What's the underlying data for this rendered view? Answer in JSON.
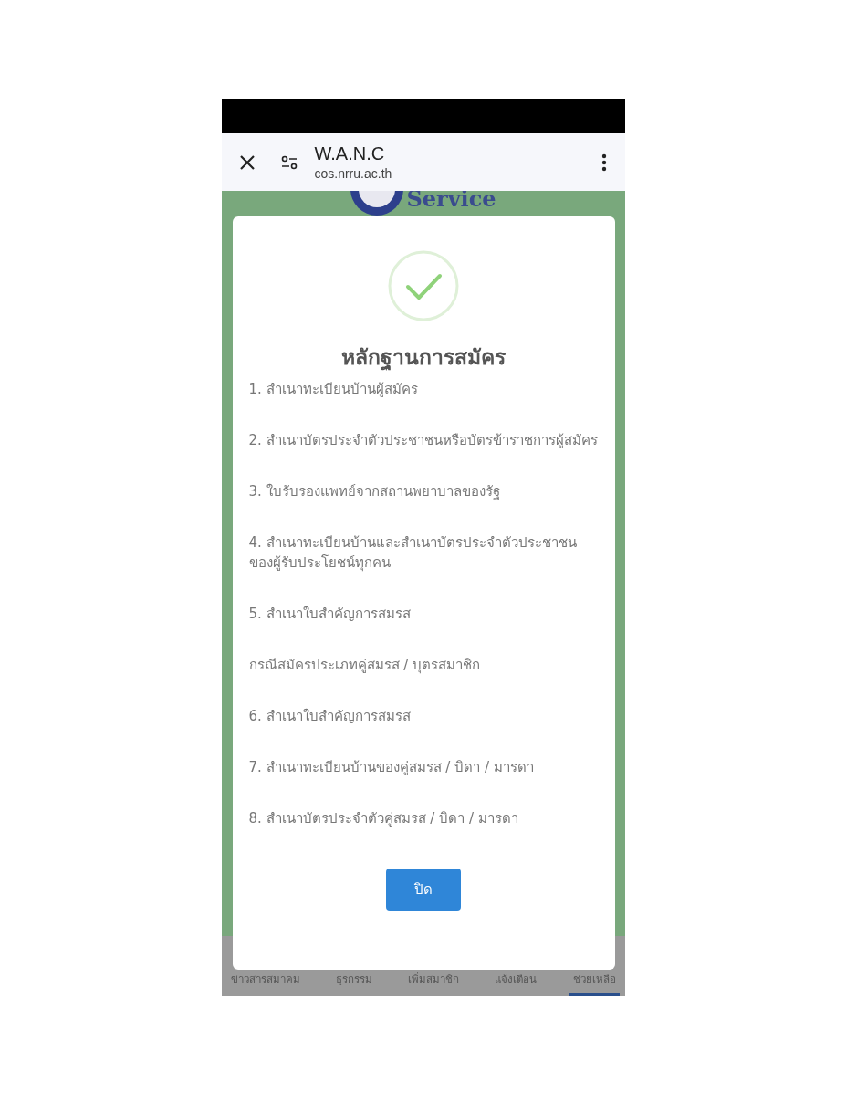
{
  "browser_bar": {
    "title": "W.A.N.C",
    "url": "cos.nrru.ac.th"
  },
  "background": {
    "logo_text": "Service"
  },
  "dialog": {
    "title": "หลักฐานการสมัคร",
    "items": [
      "1. สำเนาทะเบียนบ้านผู้สมัคร",
      "2. สำเนาบัตรประจำตัวประชาชนหรือบัตรข้าราชการผู้สมัคร",
      "3. ใบรับรองแพทย์จากสถานพยาบาลของรัฐ",
      "4. สำเนาทะเบียนบ้านและสำเนาบัตรประจำตัวประชาชนของผู้รับประโยชน์ทุกคน",
      "5. สำเนาใบสำคัญการสมรส",
      "กรณีสมัครประเภทคู่สมรส / บุตรสมาชิก",
      "6. สำเนาใบสำคัญการสมรส",
      "7. สำเนาทะเบียนบ้านของคู่สมรส / บิดา / มารดา",
      "8. สำเนาบัตรประจำตัวคู่สมรส / บิดา / มารดา"
    ],
    "button": "ปิด"
  },
  "bottom_nav": [
    {
      "label": "ข่าวสารสมาคม",
      "selected": false
    },
    {
      "label": "ธุรกรรม",
      "selected": false
    },
    {
      "label": "เพิ่มสมาชิก",
      "selected": false
    },
    {
      "label": "แจ้งเตือน",
      "selected": false
    },
    {
      "label": "ช่วยเหลือ",
      "selected": true
    }
  ]
}
